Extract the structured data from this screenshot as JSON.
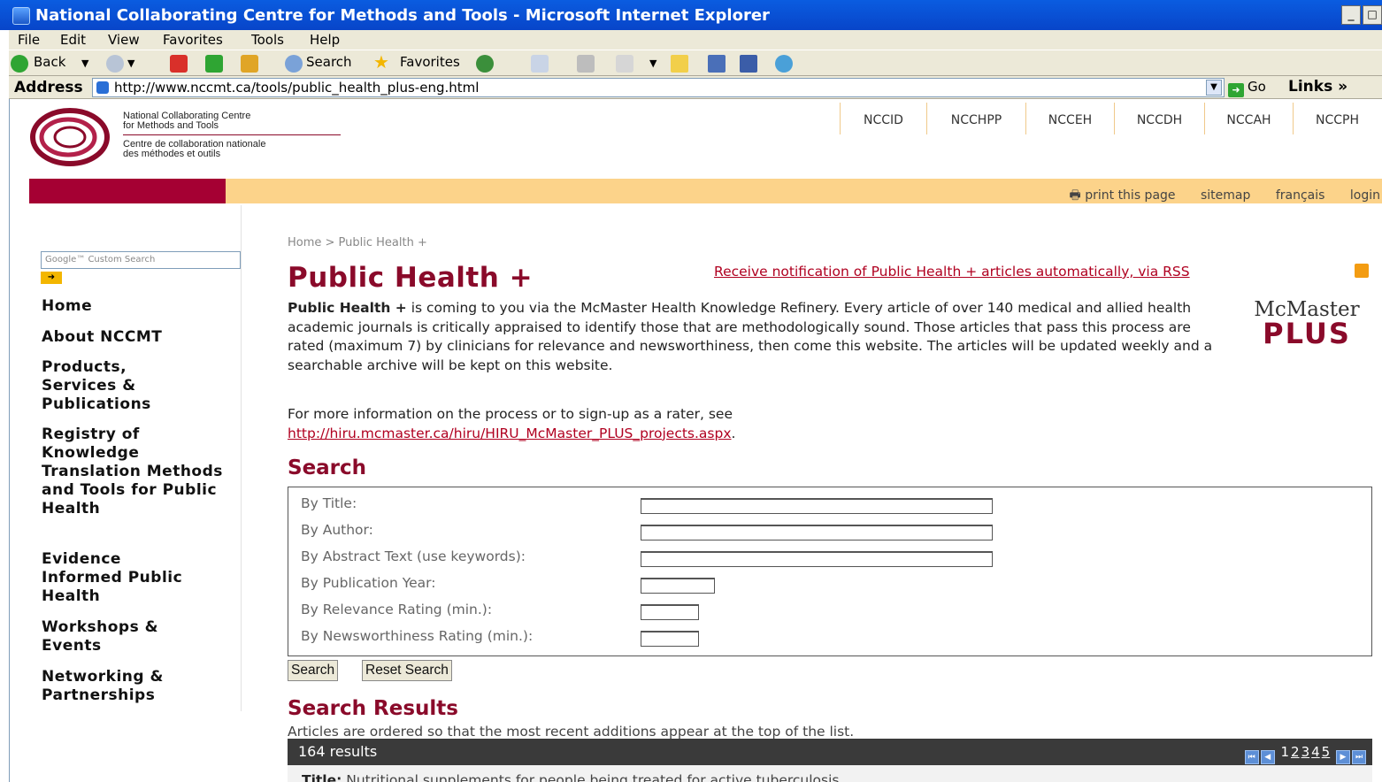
{
  "window": {
    "title": "National Collaborating Centre for Methods and Tools - Microsoft Internet Explorer",
    "min_label": "_",
    "max_label": "□"
  },
  "menubar": [
    "File",
    "Edit",
    "View",
    "Favorites",
    "Tools",
    "Help"
  ],
  "toolbar": {
    "back": "Back",
    "search": "Search",
    "favorites": "Favorites"
  },
  "address": {
    "label": "Address",
    "url": "http://www.nccmt.ca/tools/public_health_plus-eng.html",
    "go": "Go",
    "links": "Links »"
  },
  "site": {
    "org_en": "National Collaborating Centre\nfor Methods and Tools",
    "org_fr": "Centre de collaboration nationale\ndes méthodes et outils",
    "centre_tabs": [
      "NCCID",
      "NCCHPP",
      "NCCEH",
      "NCCDH",
      "NCCAH",
      "NCCPH"
    ],
    "util_links": [
      "print this page",
      "sitemap",
      "français",
      "login"
    ],
    "google_placeholder": "Google™ Custom Search",
    "nav": [
      "Home",
      "About NCCMT",
      "Products, Services & Publications",
      "Registry of Knowledge Translation Methods and Tools for Public Health",
      "Evidence Informed Public Health",
      "Workshops & Events",
      "Networking & Partnerships"
    ]
  },
  "main": {
    "breadcrumb": "Home > Public Health +",
    "title": "Public Health +",
    "rss_link": "Receive notification of Public Health + articles automatically, via RSS",
    "logo_word": "McMaster",
    "logo_plus": "PLUS",
    "intro_lead": "Public Health +",
    "intro_body": " is coming to you via the McMaster Health Knowledge Refinery. Every article of over 140 medical and allied health academic journals is critically appraised to identify those that are methodologically sound. Those articles that pass this process are rated (maximum 7) by clinicians for relevance and newsworthiness, then come this website. The articles will be updated weekly and a searchable archive will be kept on this website.",
    "more_info": "For more information on the process or to sign-up as a rater, see",
    "more_link": "http://hiru.mcmaster.ca/hiru/HIRU_McMaster_PLUS_projects.aspx",
    "more_period": "."
  },
  "search": {
    "heading": "Search",
    "fields": [
      {
        "label": "By Title:",
        "value": ""
      },
      {
        "label": "By Author:",
        "value": ""
      },
      {
        "label": "By Abstract Text (use keywords):",
        "value": ""
      },
      {
        "label": "By Publication Year:",
        "value": ""
      },
      {
        "label": "By Relevance Rating (min.):",
        "value": ""
      },
      {
        "label": "By Newsworthiness Rating (min.):",
        "value": ""
      }
    ],
    "search_button": "Search",
    "reset_button": "Reset Search"
  },
  "results": {
    "heading": "Search Results",
    "note": "Articles are ordered so that the most recent additions appear at the top of the list.",
    "count": "164 results",
    "pages": [
      "1",
      "2",
      "3",
      "4",
      "5"
    ],
    "first_title_label": "Title:",
    "first_title": "Nutritional supplements for people being treated for active tuberculosis"
  },
  "colors": {
    "brand_maroon": "#8a0a2a",
    "band_orange": "#fcd38a",
    "link_red": "#b00020",
    "title_blue": "#0a5ce0"
  }
}
